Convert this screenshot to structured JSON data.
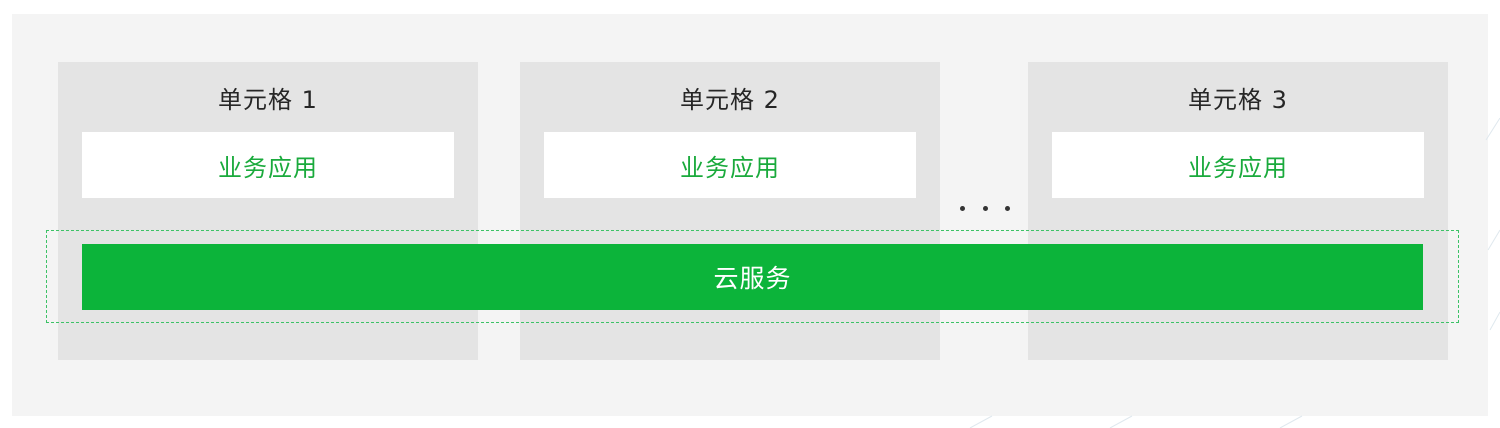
{
  "cells": [
    {
      "title": "单元格 1",
      "app_label": "业务应用"
    },
    {
      "title": "单元格 2",
      "app_label": "业务应用"
    },
    {
      "title": "单元格 3",
      "app_label": "业务应用"
    }
  ],
  "cloud_service": {
    "label": "云服务"
  },
  "colors": {
    "accent_green": "#0cb43a",
    "app_text_green": "#1aaa3c",
    "cell_gray": "#e4e4e4",
    "dashed_border": "#3cc266"
  }
}
